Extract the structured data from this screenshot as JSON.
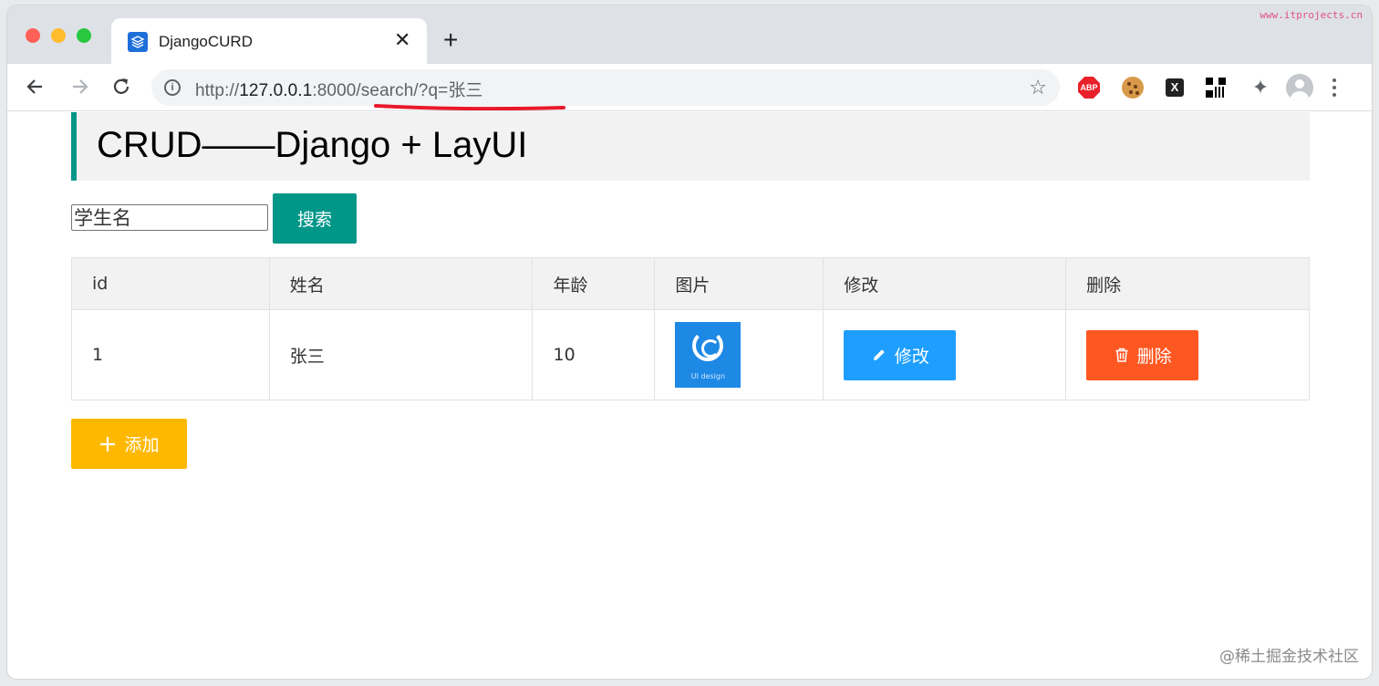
{
  "browser": {
    "tab_title": "DjangoCURD",
    "tab_close": "✕",
    "new_tab": "+",
    "url_scheme": "http://",
    "url_host": "127.0.0.1",
    "url_rest": ":8000/search/?q=张三",
    "abp_label": "ABP",
    "x_label": "X",
    "watermark_top": "www.itprojects.cn"
  },
  "page": {
    "title": "CRUD——Django + LayUI",
    "search_placeholder": "学生名",
    "search_button": "搜索",
    "add_button": "添加"
  },
  "table": {
    "headers": [
      "id",
      "姓名",
      "年龄",
      "图片",
      "修改",
      "删除"
    ],
    "rows": [
      {
        "id": "1",
        "name": "张三",
        "age": "10",
        "image_caption": "UI design",
        "edit_label": "修改",
        "delete_label": "删除"
      }
    ]
  },
  "watermark_bottom": "@稀土掘金技术社区",
  "colors": {
    "accent": "#009688",
    "edit": "#1e9fff",
    "delete": "#ff5722",
    "add": "#ffb800",
    "url_underline": "#e8192c"
  }
}
